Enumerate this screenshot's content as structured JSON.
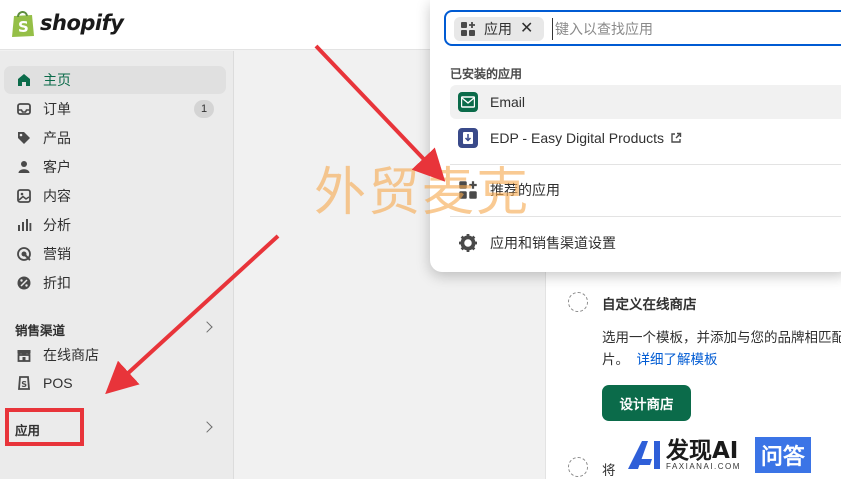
{
  "brand": {
    "name": "shopify"
  },
  "sidebar": {
    "items": [
      {
        "label": "主页",
        "icon": "home-icon",
        "active": true
      },
      {
        "label": "订单",
        "icon": "inbox-icon",
        "badge": "1"
      },
      {
        "label": "产品",
        "icon": "tag-icon"
      },
      {
        "label": "客户",
        "icon": "person-icon"
      },
      {
        "label": "内容",
        "icon": "image-icon"
      },
      {
        "label": "分析",
        "icon": "bar-chart-icon"
      },
      {
        "label": "营销",
        "icon": "target-icon"
      },
      {
        "label": "折扣",
        "icon": "discount-icon"
      }
    ],
    "sales_channels_label": "销售渠道",
    "channels": [
      {
        "label": "在线商店",
        "icon": "store-icon"
      },
      {
        "label": "POS",
        "icon": "pos-icon"
      }
    ],
    "apps_label": "应用"
  },
  "popover": {
    "chip_label": "应用",
    "search_placeholder": "键入以查找应用",
    "installed_label": "已安装的应用",
    "apps": [
      {
        "label": "Email",
        "icon": "email-app-icon"
      },
      {
        "label": "EDP - Easy Digital Products",
        "icon": "edp-app-icon"
      }
    ],
    "recommended_label": "推荐的应用",
    "settings_label": "应用和销售渠道设置"
  },
  "main": {
    "task_title": "自定义在线商店",
    "task_desc_line1": "选用一个模板，并添加与您的品牌相匹配",
    "task_desc_line2": "片。",
    "task_link": "详细了解模板",
    "design_button": "设计商店",
    "next_task_partial": "将"
  },
  "watermark": "外贸麦克",
  "footer_logo": {
    "name": "发现AI",
    "sub": "FAXIANAI.COM",
    "qa": "问答"
  },
  "colors": {
    "accent_green": "#0b6b4a",
    "link_blue": "#005bd3",
    "annotation_red": "#e8343a"
  }
}
